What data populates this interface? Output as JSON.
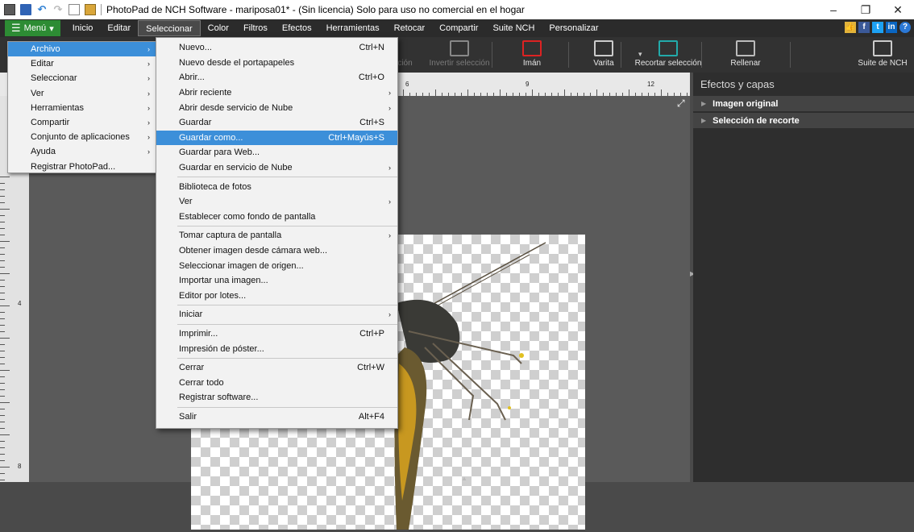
{
  "window": {
    "title": "PhotoPad de NCH Software - mariposa01* - (Sin licencia) Solo para uso no comercial en el hogar",
    "minimize": "–",
    "restore": "❐",
    "close": "✕"
  },
  "menubar": {
    "menu_label": "Menú",
    "tabs": [
      "Inicio",
      "Editar",
      "Seleccionar",
      "Color",
      "Filtros",
      "Efectos",
      "Herramientas",
      "Retocar",
      "Compartir",
      "Suite NCH",
      "Personalizar"
    ],
    "active_tab": "Seleccionar"
  },
  "toolbar": {
    "items": [
      {
        "label": "cción",
        "icon": "selection-icon",
        "dim": true
      },
      {
        "label": "Invertir selección",
        "icon": "invert-selection-icon",
        "dim": true
      },
      {
        "label": "Imán",
        "icon": "magnet-icon",
        "dim": false
      },
      {
        "label": "Varita",
        "icon": "magic-wand-icon",
        "dim": false
      },
      {
        "label": "Recortar selección",
        "icon": "crop-selection-icon",
        "dim": false
      },
      {
        "label": "Rellenar",
        "icon": "fill-bucket-icon",
        "dim": false
      },
      {
        "label": "Suite de NCH",
        "icon": "nch-suite-icon",
        "dim": false
      }
    ]
  },
  "ruler": {
    "h_labels": [
      "6",
      "9",
      "12"
    ],
    "v_labels": [
      "4",
      "8"
    ]
  },
  "panel": {
    "title": "Efectos y capas",
    "items": [
      "Imagen original",
      "Selección de recorte"
    ]
  },
  "main_menu": {
    "items": [
      {
        "label": "Archivo",
        "has_sub": true,
        "highlight": true
      },
      {
        "label": "Editar",
        "has_sub": true
      },
      {
        "label": "Seleccionar",
        "has_sub": true
      },
      {
        "label": "Ver",
        "has_sub": true
      },
      {
        "label": "Herramientas",
        "has_sub": true
      },
      {
        "label": "Compartir",
        "has_sub": true
      },
      {
        "label": "Conjunto de aplicaciones",
        "has_sub": true
      },
      {
        "label": "Ayuda",
        "has_sub": true
      },
      {
        "label": "Registrar PhotoPad...",
        "has_sub": false
      }
    ]
  },
  "archivo_menu": {
    "groups": [
      [
        {
          "label": "Nuevo...",
          "shortcut": "Ctrl+N"
        },
        {
          "label": "Nuevo desde el portapapeles",
          "shortcut": ""
        },
        {
          "label": "Abrir...",
          "shortcut": "Ctrl+O"
        },
        {
          "label": "Abrir reciente",
          "shortcut": "",
          "sub": true
        },
        {
          "label": "Abrir desde servicio de Nube",
          "shortcut": "",
          "sub": true
        },
        {
          "label": "Guardar",
          "shortcut": "Ctrl+S"
        },
        {
          "label": "Guardar como...",
          "shortcut": "Ctrl+Mayús+S",
          "highlight": true
        },
        {
          "label": "Guardar para Web...",
          "shortcut": ""
        },
        {
          "label": "Guardar en servicio de Nube",
          "shortcut": "",
          "sub": true
        }
      ],
      [
        {
          "label": "Biblioteca de fotos",
          "shortcut": ""
        },
        {
          "label": "Ver",
          "shortcut": "",
          "sub": true
        },
        {
          "label": "Establecer como fondo de pantalla",
          "shortcut": ""
        }
      ],
      [
        {
          "label": "Tomar captura de pantalla",
          "shortcut": "",
          "sub": true
        },
        {
          "label": "Obtener imagen desde cámara web...",
          "shortcut": ""
        },
        {
          "label": "Seleccionar imagen de origen...",
          "shortcut": ""
        },
        {
          "label": "Importar una imagen...",
          "shortcut": ""
        },
        {
          "label": "Editor por lotes...",
          "shortcut": ""
        }
      ],
      [
        {
          "label": "Iniciar",
          "shortcut": "",
          "sub": true
        }
      ],
      [
        {
          "label": "Imprimir...",
          "shortcut": "Ctrl+P"
        },
        {
          "label": "Impresión de póster...",
          "shortcut": ""
        }
      ],
      [
        {
          "label": "Cerrar",
          "shortcut": "Ctrl+W"
        },
        {
          "label": "Cerrar todo",
          "shortcut": ""
        },
        {
          "label": "Registrar software...",
          "shortcut": ""
        }
      ],
      [
        {
          "label": "Salir",
          "shortcut": "Alt+F4"
        }
      ]
    ]
  },
  "colors": {
    "menu_button": "#2d8c34",
    "highlight": "#3c8fd9"
  }
}
